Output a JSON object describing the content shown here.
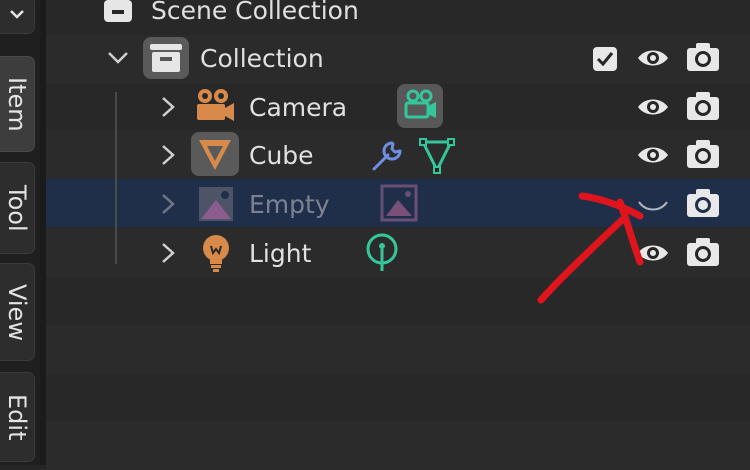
{
  "sidebar": {
    "tabs": [
      {
        "label": "Item",
        "active": true
      },
      {
        "label": "Tool",
        "active": false
      },
      {
        "label": "View",
        "active": false
      },
      {
        "label": "Edit",
        "active": false
      }
    ]
  },
  "outliner": {
    "root": {
      "label": "Scene Collection"
    },
    "collection": {
      "label": "Collection",
      "checked": true
    },
    "objects": [
      {
        "label": "Camera",
        "icon": "camera-object-icon",
        "data_icon": "camera-data-icon",
        "visible": true
      },
      {
        "label": "Cube",
        "icon": "mesh-object-icon",
        "modifier_icon": "wrench-icon",
        "data_icon": "mesh-data-icon",
        "visible": true
      },
      {
        "label": "Empty",
        "icon": "empty-object-icon",
        "data_icon": "image-data-icon",
        "visible": false,
        "selected": true
      },
      {
        "label": "Light",
        "icon": "light-object-icon",
        "data_icon": "light-data-icon",
        "visible": true
      }
    ]
  },
  "colors": {
    "camera": "#d78a4a",
    "data_green": "#34c79a",
    "wrench_blue": "#6e8fe0",
    "empty_purple": "#8d5d8d",
    "selection": "#1f2f4a",
    "annotation_red": "#e0141c"
  }
}
